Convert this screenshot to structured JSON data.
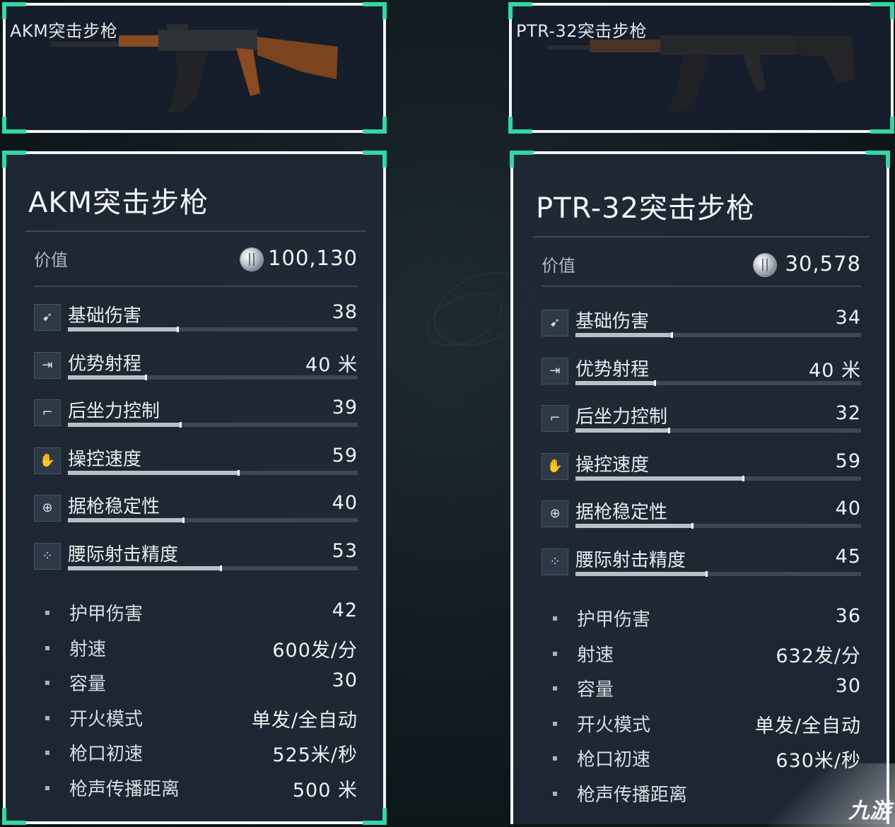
{
  "left": {
    "image_label": "AKM突击步枪",
    "title": "AKM突击步枪",
    "value_label": "价值",
    "value": "100,130",
    "stats": [
      {
        "label": "基础伤害",
        "value": "38",
        "level": 0.38,
        "icon": "bullet-damage-icon",
        "glyph": "➹"
      },
      {
        "label": "优势射程",
        "value": "40 米",
        "level": 0.27,
        "icon": "range-arrow-icon",
        "glyph": "⇥"
      },
      {
        "label": "后坐力控制",
        "value": "39",
        "level": 0.39,
        "icon": "pistol-recoil-icon",
        "glyph": "⌐"
      },
      {
        "label": "操控速度",
        "value": "59",
        "level": 0.59,
        "icon": "handling-hand-icon",
        "glyph": "✋"
      },
      {
        "label": "据枪稳定性",
        "value": "40",
        "level": 0.4,
        "icon": "crosshair-stability-icon",
        "glyph": "⊕"
      },
      {
        "label": "腰际射击精度",
        "value": "53",
        "level": 0.53,
        "icon": "hipfire-reticle-icon",
        "glyph": "⁘"
      }
    ],
    "specs": [
      {
        "label": "护甲伤害",
        "value": "42"
      },
      {
        "label": "射速",
        "value": "600发/分"
      },
      {
        "label": "容量",
        "value": "30"
      },
      {
        "label": "开火模式",
        "value": "单发/全自动"
      },
      {
        "label": "枪口初速",
        "value": "525米/秒"
      },
      {
        "label": "枪声传播距离",
        "value": "500 米"
      }
    ]
  },
  "right": {
    "image_label": "PTR-32突击步枪",
    "title": "PTR-32突击步枪",
    "value_label": "价值",
    "value": "30,578",
    "stats": [
      {
        "label": "基础伤害",
        "value": "34",
        "level": 0.34,
        "icon": "bullet-damage-icon",
        "glyph": "➹"
      },
      {
        "label": "优势射程",
        "value": "40 米",
        "level": 0.28,
        "icon": "range-arrow-icon",
        "glyph": "⇥"
      },
      {
        "label": "后坐力控制",
        "value": "32",
        "level": 0.33,
        "icon": "pistol-recoil-icon",
        "glyph": "⌐"
      },
      {
        "label": "操控速度",
        "value": "59",
        "level": 0.59,
        "icon": "handling-hand-icon",
        "glyph": "✋"
      },
      {
        "label": "据枪稳定性",
        "value": "40",
        "level": 0.41,
        "icon": "crosshair-stability-icon",
        "glyph": "⊕"
      },
      {
        "label": "腰际射击精度",
        "value": "45",
        "level": 0.46,
        "icon": "hipfire-reticle-icon",
        "glyph": "⁘"
      }
    ],
    "specs": [
      {
        "label": "护甲伤害",
        "value": "36"
      },
      {
        "label": "射速",
        "value": "632发/分"
      },
      {
        "label": "容量",
        "value": "30"
      },
      {
        "label": "开火模式",
        "value": "单发/全自动"
      },
      {
        "label": "枪口初速",
        "value": "630米/秒"
      },
      {
        "label": "枪声传播距离",
        "value": ""
      }
    ]
  },
  "watermark": "九游",
  "colors": {
    "accent": "#33d6a6",
    "frame": "#f2f5f5",
    "panel": "#202a37"
  }
}
